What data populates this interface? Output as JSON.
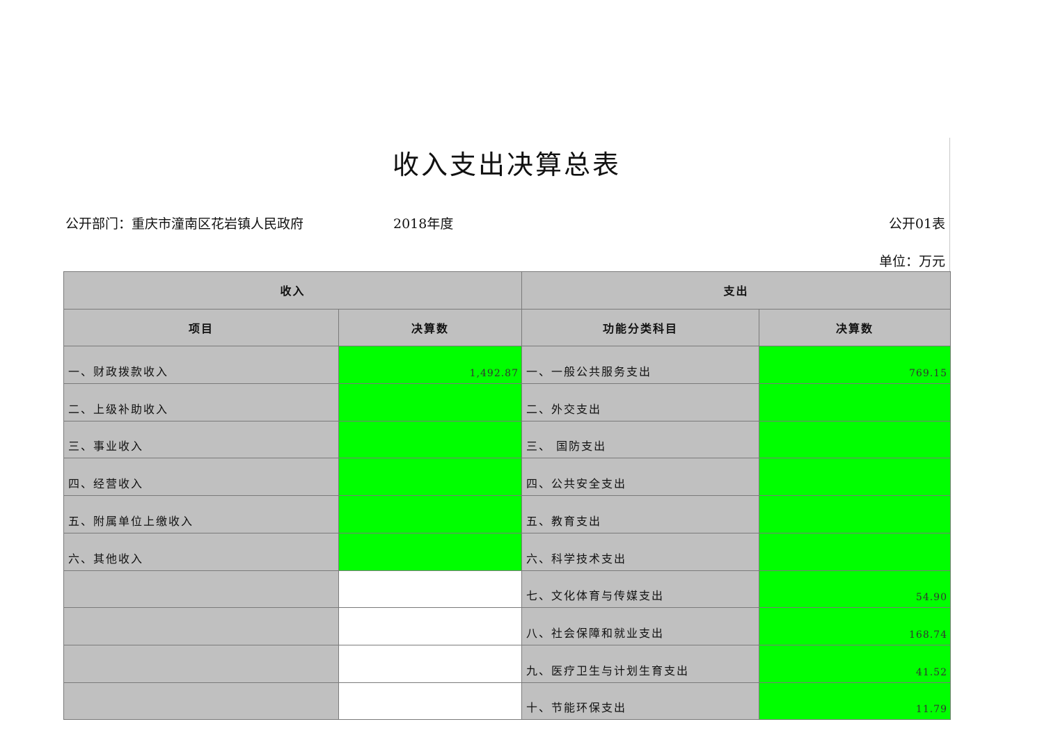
{
  "title": "收入支出决算总表",
  "department": "公开部门：重庆市潼南区花岩镇人民政府",
  "year": "2018年度",
  "form_no": "公开01表",
  "unit": "单位：万元",
  "colors": {
    "header_bg": "#c0c0c0",
    "value_bg": "#00ff00",
    "blank_bg": "#ffffff"
  },
  "headers": {
    "income": "收入",
    "expenditure": "支出",
    "income_item": "项目",
    "income_amount": "决算数",
    "exp_item": "功能分类科目",
    "exp_amount": "决算数"
  },
  "rows": [
    {
      "income_item": "一、财政拨款收入",
      "income_amount": "1,492.87",
      "exp_item": "一、一般公共服务支出",
      "exp_amount": "769.15"
    },
    {
      "income_item": "二、上级补助收入",
      "income_amount": "",
      "exp_item": "二、外交支出",
      "exp_amount": ""
    },
    {
      "income_item": "三、事业收入",
      "income_amount": "",
      "exp_item": "三、 国防支出",
      "exp_amount": ""
    },
    {
      "income_item": "四、经营收入",
      "income_amount": "",
      "exp_item": "四、公共安全支出",
      "exp_amount": ""
    },
    {
      "income_item": "五、附属单位上缴收入",
      "income_amount": "",
      "exp_item": "五、教育支出",
      "exp_amount": ""
    },
    {
      "income_item": "六、其他收入",
      "income_amount": "",
      "exp_item": "六、科学技术支出",
      "exp_amount": ""
    },
    {
      "income_item": "",
      "income_amount": "",
      "exp_item": "七、文化体育与传媒支出",
      "exp_amount": "54.90"
    },
    {
      "income_item": "",
      "income_amount": "",
      "exp_item": "八、社会保障和就业支出",
      "exp_amount": "168.74"
    },
    {
      "income_item": "",
      "income_amount": "",
      "exp_item": "九、医疗卫生与计划生育支出",
      "exp_amount": "41.52"
    },
    {
      "income_item": "",
      "income_amount": "",
      "exp_item": "十、节能环保支出",
      "exp_amount": "11.79"
    }
  ]
}
